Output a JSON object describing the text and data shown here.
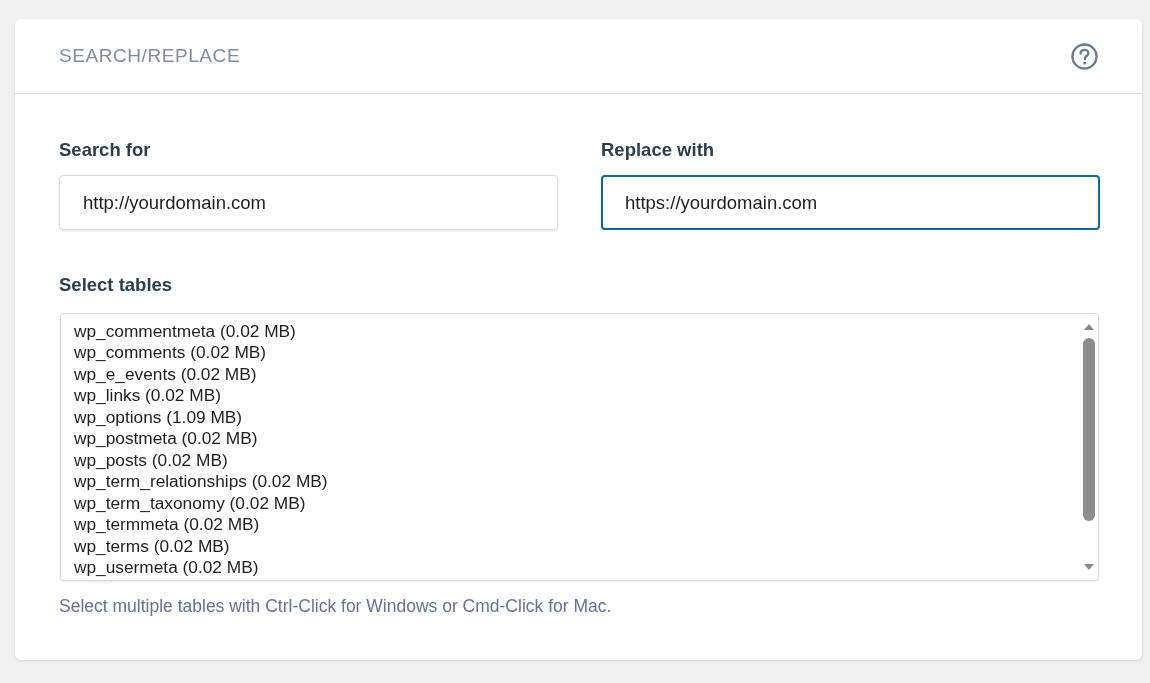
{
  "panel": {
    "title": "SEARCH/REPLACE"
  },
  "fields": [
    {
      "label": "Search for",
      "value": "http://yourdomain.com",
      "focused": false
    },
    {
      "label": "Replace with",
      "value": "https://yourdomain.com",
      "focused": true
    }
  ],
  "tables": {
    "label": "Select tables",
    "options": [
      {
        "text": "wp_commentmeta (0.02 MB)",
        "selected": false
      },
      {
        "text": "wp_comments (0.02 MB)",
        "selected": false
      },
      {
        "text": "wp_e_events (0.02 MB)",
        "selected": false
      },
      {
        "text": "wp_links (0.02 MB)",
        "selected": false
      },
      {
        "text": "wp_options (1.09 MB)",
        "selected": false
      },
      {
        "text": "wp_postmeta (0.02 MB)",
        "selected": false
      },
      {
        "text": "wp_posts (0.02 MB)",
        "selected": false
      },
      {
        "text": "wp_term_relationships (0.02 MB)",
        "selected": false
      },
      {
        "text": "wp_term_taxonomy (0.02 MB)",
        "selected": false
      },
      {
        "text": "wp_termmeta (0.02 MB)",
        "selected": false
      },
      {
        "text": "wp_terms (0.02 MB)",
        "selected": false
      },
      {
        "text": "wp_usermeta (0.02 MB)",
        "selected": false
      }
    ],
    "hint": "Select multiple tables with Ctrl-Click for Windows or Cmd-Click for Mac."
  }
}
